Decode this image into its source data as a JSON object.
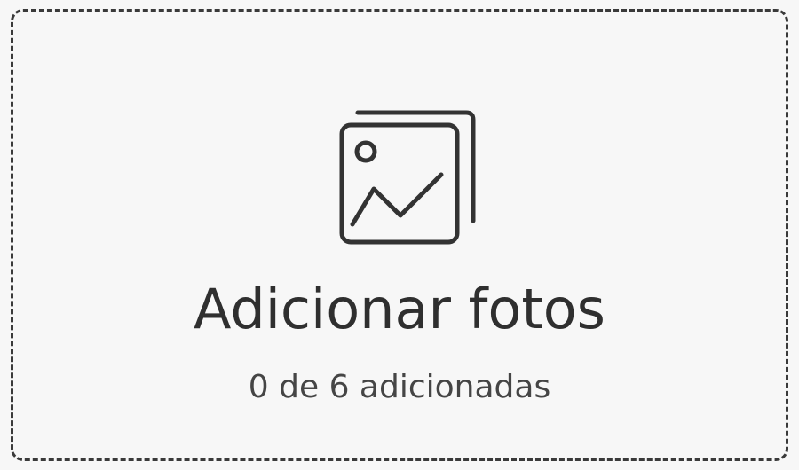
{
  "upload": {
    "icon": "photo-gallery-icon",
    "title": "Adicionar fotos",
    "counter": "0 de 6 adicionadas",
    "added_count": 0,
    "max_count": 6
  },
  "colors": {
    "background": "#f7f7f7",
    "border": "#3a3a3a",
    "icon": "#333333",
    "title": "#2f2f2f",
    "counter": "#454545"
  }
}
